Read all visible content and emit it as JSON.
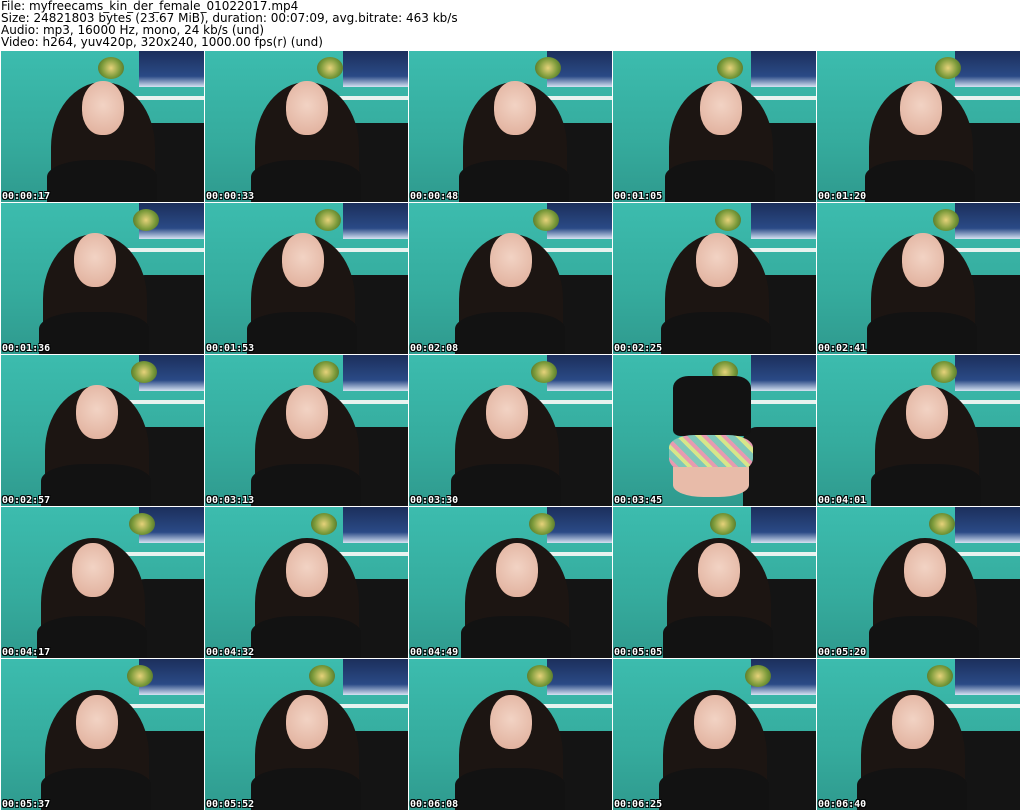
{
  "header": {
    "file_line": "File: myfreecams_kin_der_female_01022017.mp4",
    "size_line": "Size: 24821803 bytes (23.67 MiB), duration: 00:07:09, avg.bitrate: 463 kb/s",
    "audio_line": "Audio: mp3, 16000 Hz, mono, 24 kb/s (und)",
    "video_line": "Video: h264, yuv420p, 320x240, 1000.00 fps(r) (und)"
  },
  "thumbnails": [
    {
      "timestamp": "00:00:17"
    },
    {
      "timestamp": "00:00:33"
    },
    {
      "timestamp": "00:00:48"
    },
    {
      "timestamp": "00:01:05"
    },
    {
      "timestamp": "00:01:20"
    },
    {
      "timestamp": "00:01:36"
    },
    {
      "timestamp": "00:01:53"
    },
    {
      "timestamp": "00:02:08"
    },
    {
      "timestamp": "00:02:25"
    },
    {
      "timestamp": "00:02:41"
    },
    {
      "timestamp": "00:02:57"
    },
    {
      "timestamp": "00:03:13"
    },
    {
      "timestamp": "00:03:30"
    },
    {
      "timestamp": "00:03:45"
    },
    {
      "timestamp": "00:04:01"
    },
    {
      "timestamp": "00:04:17"
    },
    {
      "timestamp": "00:04:32"
    },
    {
      "timestamp": "00:04:49"
    },
    {
      "timestamp": "00:05:05"
    },
    {
      "timestamp": "00:05:20"
    },
    {
      "timestamp": "00:05:37"
    },
    {
      "timestamp": "00:05:52"
    },
    {
      "timestamp": "00:06:08"
    },
    {
      "timestamp": "00:06:25"
    },
    {
      "timestamp": "00:06:40"
    }
  ]
}
